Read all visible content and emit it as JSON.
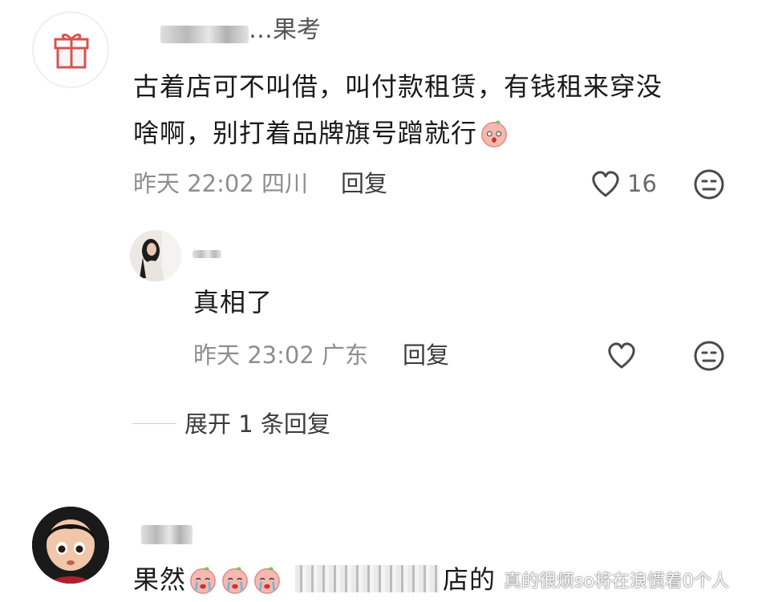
{
  "comments": [
    {
      "username": "…果考",
      "text_line1": "古着店可不叫借，叫付款租赁，有钱租来穿没",
      "text_line2": "啥啊，别打着品牌旗号蹭就行",
      "time": "昨天 22:02",
      "location": "四川",
      "reply_label": "回复",
      "likes": "16",
      "emoji": "peach-face"
    }
  ],
  "sub_reply": {
    "text": "真相了",
    "time": "昨天 23:02",
    "location": "广东",
    "reply_label": "回复"
  },
  "expand_label": "展开 1 条回复",
  "third_comment": {
    "text_start": "果然",
    "text_end": "店的"
  },
  "watermark": "真的很烦so将在浪惯着0个人",
  "icons": {
    "gift": "gift-icon",
    "heart": "heart-icon",
    "emoji": "neutral-face-icon"
  }
}
